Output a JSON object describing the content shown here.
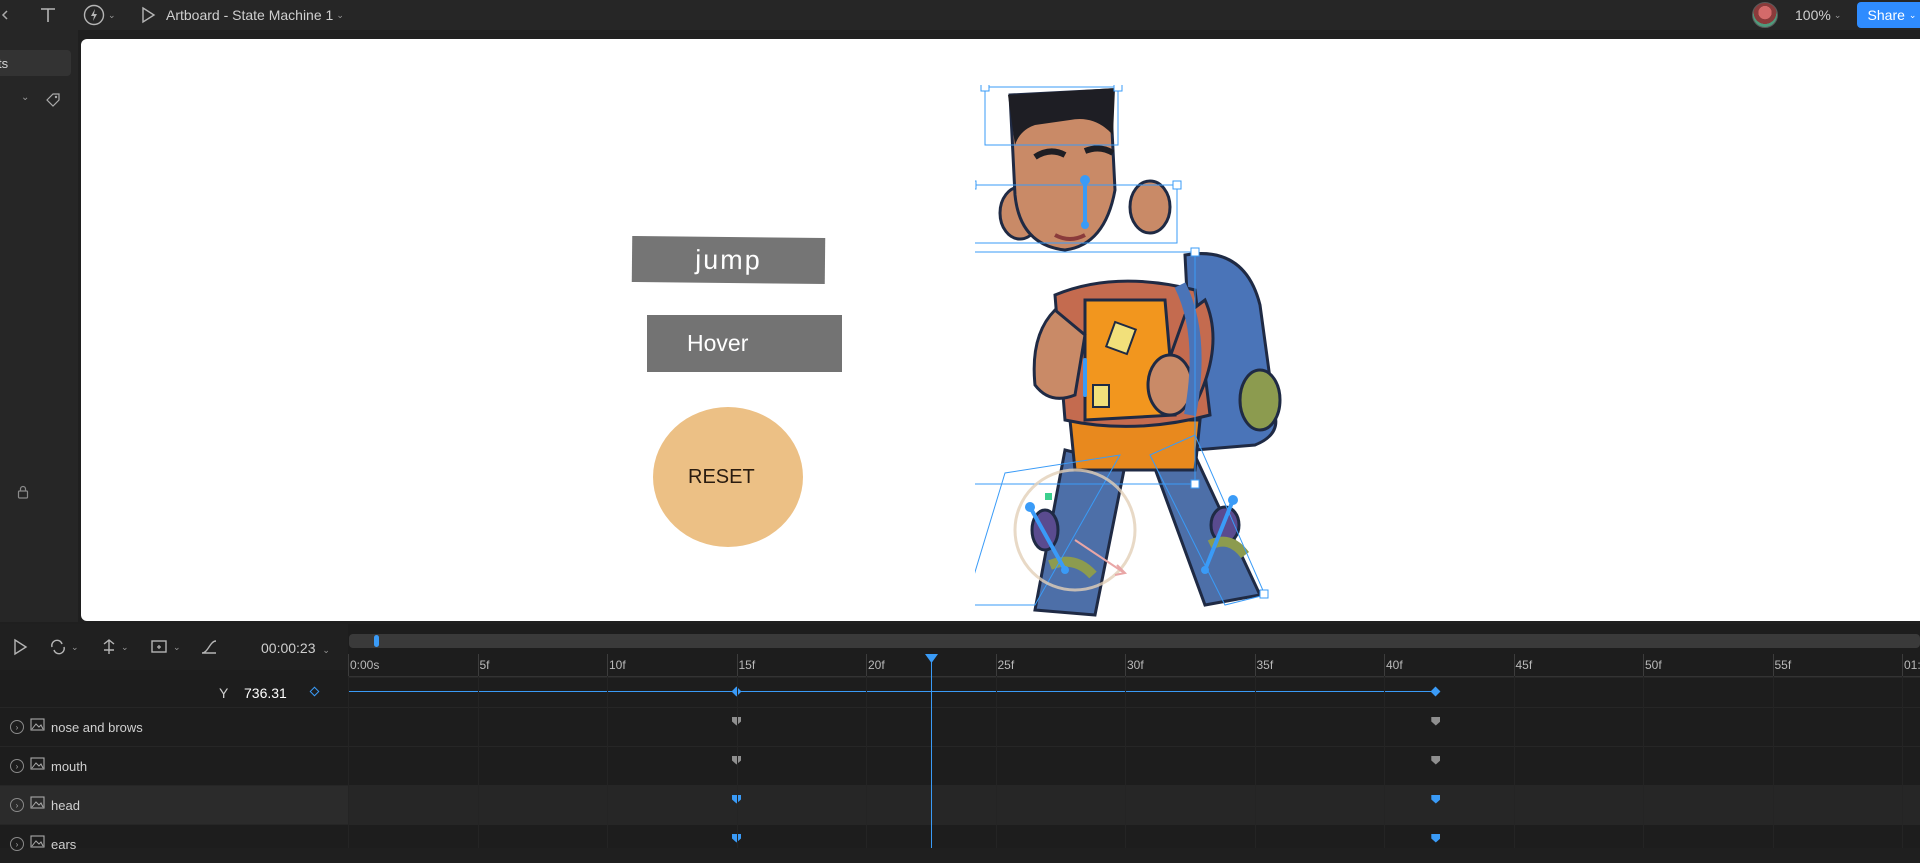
{
  "toolbar": {
    "artboard_title": "Artboard - State Machine 1",
    "zoom": "100%",
    "share_label": "Share"
  },
  "left_panel": {
    "tab_label": "ts"
  },
  "canvas": {
    "jump_label": "jump",
    "hover_label": "Hover",
    "reset_label": "RESET"
  },
  "timeline": {
    "timecode": "00:00:23",
    "ruler_labels": [
      "0:00s",
      "5f",
      "10f",
      "15f",
      "20f",
      "25f",
      "30f",
      "35f",
      "40f",
      "45f",
      "50f",
      "55f",
      "01:0"
    ],
    "property": {
      "label": "Y",
      "value": "736.31"
    },
    "layers": [
      {
        "name": "nose and brows"
      },
      {
        "name": "mouth"
      },
      {
        "name": "head"
      },
      {
        "name": "ears"
      }
    ],
    "keyframe_frames": [
      15,
      42
    ],
    "playhead_frame": 22.5
  },
  "colors": {
    "accent": "#3a9bf7",
    "share": "#2f8cff",
    "reset_button": "#ecc085",
    "ui_button": "#757575"
  }
}
